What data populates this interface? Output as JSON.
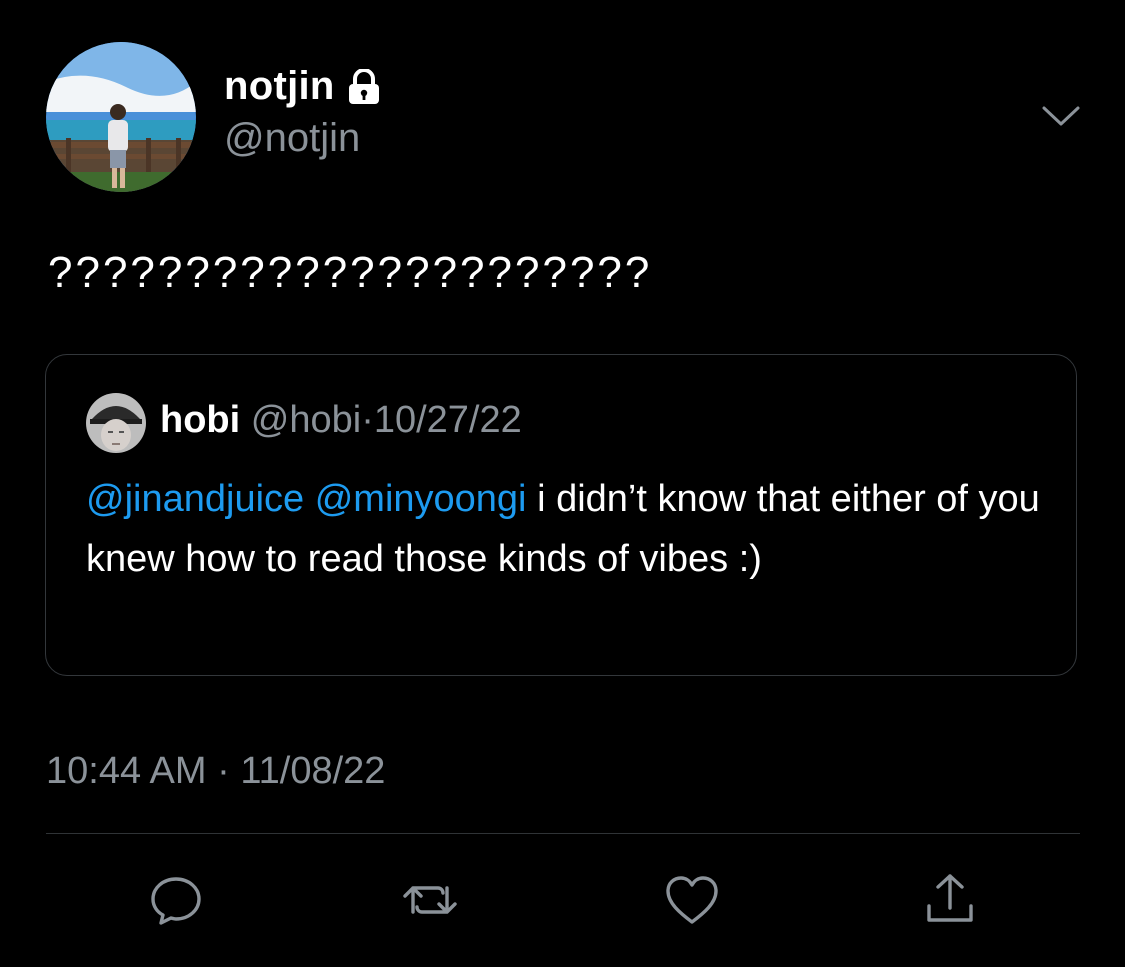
{
  "author": {
    "display_name": "notjin",
    "handle": "@notjin",
    "avatar_icon": "beach-photo-avatar",
    "protected_icon": "lock-icon"
  },
  "tweet": {
    "text": "??????????????????????",
    "timestamp": "10:44 AM · 11/08/22"
  },
  "quoted_tweet": {
    "display_name": "hobi",
    "handle": "@hobi",
    "separator": "·",
    "date": "10/27/22",
    "mention_1": "@jinandjuice",
    "mention_2": "@minyoongi",
    "text": " i didn’t know that either of you knew how to read those kinds of vibes :)"
  },
  "actions": {
    "reply_icon": "reply-icon",
    "retweet_icon": "retweet-icon",
    "like_icon": "heart-icon",
    "share_icon": "share-icon"
  },
  "colors": {
    "background": "#000000",
    "secondary_text": "#8b9299",
    "link": "#1d9bf0",
    "border": "#33373b"
  }
}
